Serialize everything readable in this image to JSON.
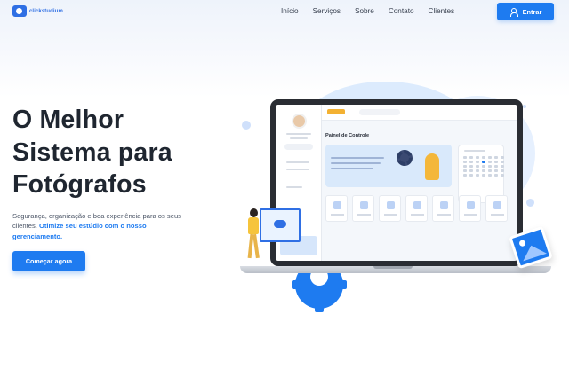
{
  "brand": {
    "name": "clickstudium",
    "accent": "#1e7bf0"
  },
  "nav": {
    "items": [
      "Início",
      "Serviços",
      "Sobre",
      "Contato",
      "Clientes"
    ],
    "login_label": "Entrar"
  },
  "hero": {
    "title_lines": [
      "O Melhor",
      "Sistema para",
      "Fotógrafos"
    ],
    "subtitle_plain": "Segurança, organização e boa experiência para os seus clientes. ",
    "subtitle_highlight": "Otimize seu estúdio com o nosso gerenciamento.",
    "cta_label": "Começar agora"
  },
  "illustration": {
    "dashboard_title": "Painel de Controle"
  }
}
